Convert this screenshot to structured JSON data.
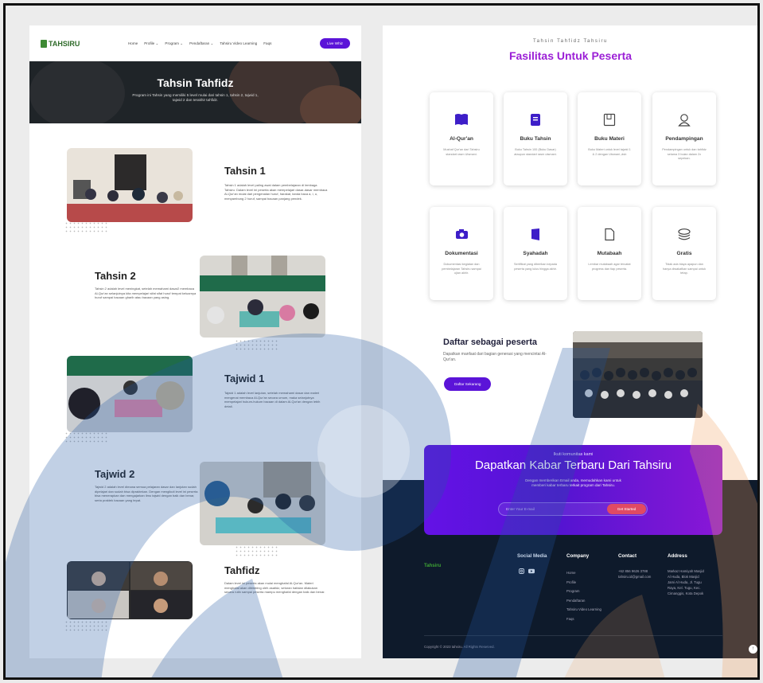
{
  "nav": {
    "logo": "TAHSIRU",
    "items": [
      "Home",
      "Profile",
      "Program",
      "Pendaftaran",
      "Tahsiru Video Learning",
      "Faqs"
    ],
    "chevron": "⌄",
    "cta": "Live Whiz"
  },
  "hero": {
    "title": "Tahsin Tahfidz",
    "subtitle": "Program ini Tahsin yang memiliki 5 level mulai dari tahsin 1, tahsin 2, tajwid 1, tajwid 2 dan terakhir tahfidz."
  },
  "sections": [
    {
      "title": "Tahsin 1",
      "text": "Tahsin 1 adalah level paling awal dalam pembelajaran di lembaga Tahsiru. Dalam level ini peserta akan mempelajari dasar-dasar membaca Al-Qur'an mulai dari pengenalan huruf, harakat, tanda baca a, i, u, menyambung 2 huruf, sampai bacaan panjang pendek."
    },
    {
      "title": "Tahsin 2",
      "text": "Tahsin 2 adalah level meningkat, setelah memahami dasar2 membaca Al-Qur'an selanjutnya kita mempelajari sifat sifat huruf tempat keluarnya huruf sampai bacaan gharib atau bacaan yang asing."
    },
    {
      "title": "Tajwid 1",
      "text": "Tajwid 1 adalah level lanjutan, setelah memahami dasar dan materi mengenai membaca Al-Qur'an secara umum, maka selanjutnya mempelajari hukum-hukum bacaan di dalam Al-Qur'an dengan lebih detail."
    },
    {
      "title": "Tajwid 2",
      "text": "Tajwid 2 adalah level dimana semua pelajaran dasar dan lanjutan sudah dipelajari dan sudah bisa dipraktekan. Dengan mengikuti level ini peserta bisa menerapkan dan mengajarkan ilmu tajwid dengan baik dan benar, serta praktek bacaan yang tepat."
    },
    {
      "title": "Tahfidz",
      "text": "Dalam level ini peserta akan mulai menghafal Al-Qur'an. Materi menghafal akan dibimbing oleh asatidz, setoran hafalan dilakukan secara rutin sampai peserta mampu menghafal dengan baik dan benar."
    }
  ],
  "right": {
    "kicker": "Tahsin Tahfidz Tahsiru",
    "title": "Fasilitas Untuk Peserta",
    "cards": [
      {
        "title": "Al-Qur'an",
        "desc": "Mushaf Qur'an dari Tahsiru standart rasm Utsmani."
      },
      {
        "title": "Buku Tahsin",
        "desc": "Buku Tahsin 100 (Buku Dasar) ataupun standart rasm utsmani."
      },
      {
        "title": "Buku Materi",
        "desc": "Buku Materi untuk level tajwid 1 & 2 dengan Utsmani.,dsb"
      },
      {
        "title": "Pendampingan",
        "desc": "Pendampingan untuk dan tahfidz selama 3 bulan dalam 2x sepekan."
      },
      {
        "title": "Dokumentasi",
        "desc": "Dokumentasi kegiatan dan pembelajaran Tahsiru sampai ujian akhir."
      },
      {
        "title": "Syahadah",
        "desc": "Sertifikat yang diberikan kepada peserta yang lulus hingga akhir."
      },
      {
        "title": "Mutabaah",
        "desc": "Lembar mutabaah agar tercatat progress dan tiap peserta."
      },
      {
        "title": "Gratis",
        "desc": "Tidak ada biaya apapun dan hanya diwakafkan sampai untuk tetap."
      }
    ],
    "cta": {
      "title": "Daftar sebagai peserta",
      "subtitle": "Dapatkan manfaat dari bagian generasi yang mencintai Al-Qur'an.",
      "button": "Daftar Sekarang"
    },
    "newsletter": {
      "kicker": "Ikuti komunitas kami",
      "title": "Dapatkan Kabar Terbaru Dari Tahsiru",
      "subtitle": "Dengan memberikan Email anda, memudahkan kami untuk memberi kabar terbaru terkait program dari Tahsiru.",
      "placeholder": "Enter Your E-mail",
      "button": "Get Started"
    },
    "footer": {
      "social_title": "Social Media",
      "company_title": "Company",
      "company_items": [
        "Home",
        "Profile",
        "Program",
        "Pendaftaran",
        "Tahsiru Video Learning",
        "Faqs"
      ],
      "contact_title": "Contact",
      "contact_phone": "+62 856 9626 3788",
      "contact_email": "tahsiru.id@gmail.com",
      "address_title": "Address",
      "address_text": "Markaz Hamiyah Masjid Al Huda, Blok Masjid Jami Al Huda, Jl. Tugu Raya, Kel. Tugu, Kec. Cimanggis, Kota Depok",
      "copyright": "Copyright © 2023 tahsiru. All Rights Reserved.",
      "logo": "Tahsiru"
    }
  },
  "icons": {
    "book": "book-icon",
    "buku": "notebook-icon",
    "materi": "document-icon",
    "mentor": "user-icon",
    "camera": "camera-icon",
    "cert": "certificate-icon",
    "file": "file-icon",
    "coins": "coins-icon",
    "instagram": "instagram-icon",
    "youtube": "youtube-icon",
    "arrow-up": "arrow-up-icon"
  },
  "colors": {
    "accent": "#5b14d8",
    "title_purple": "#9b1fd6",
    "footer": "#0e1a2b",
    "news_btn": "#e04a63"
  }
}
